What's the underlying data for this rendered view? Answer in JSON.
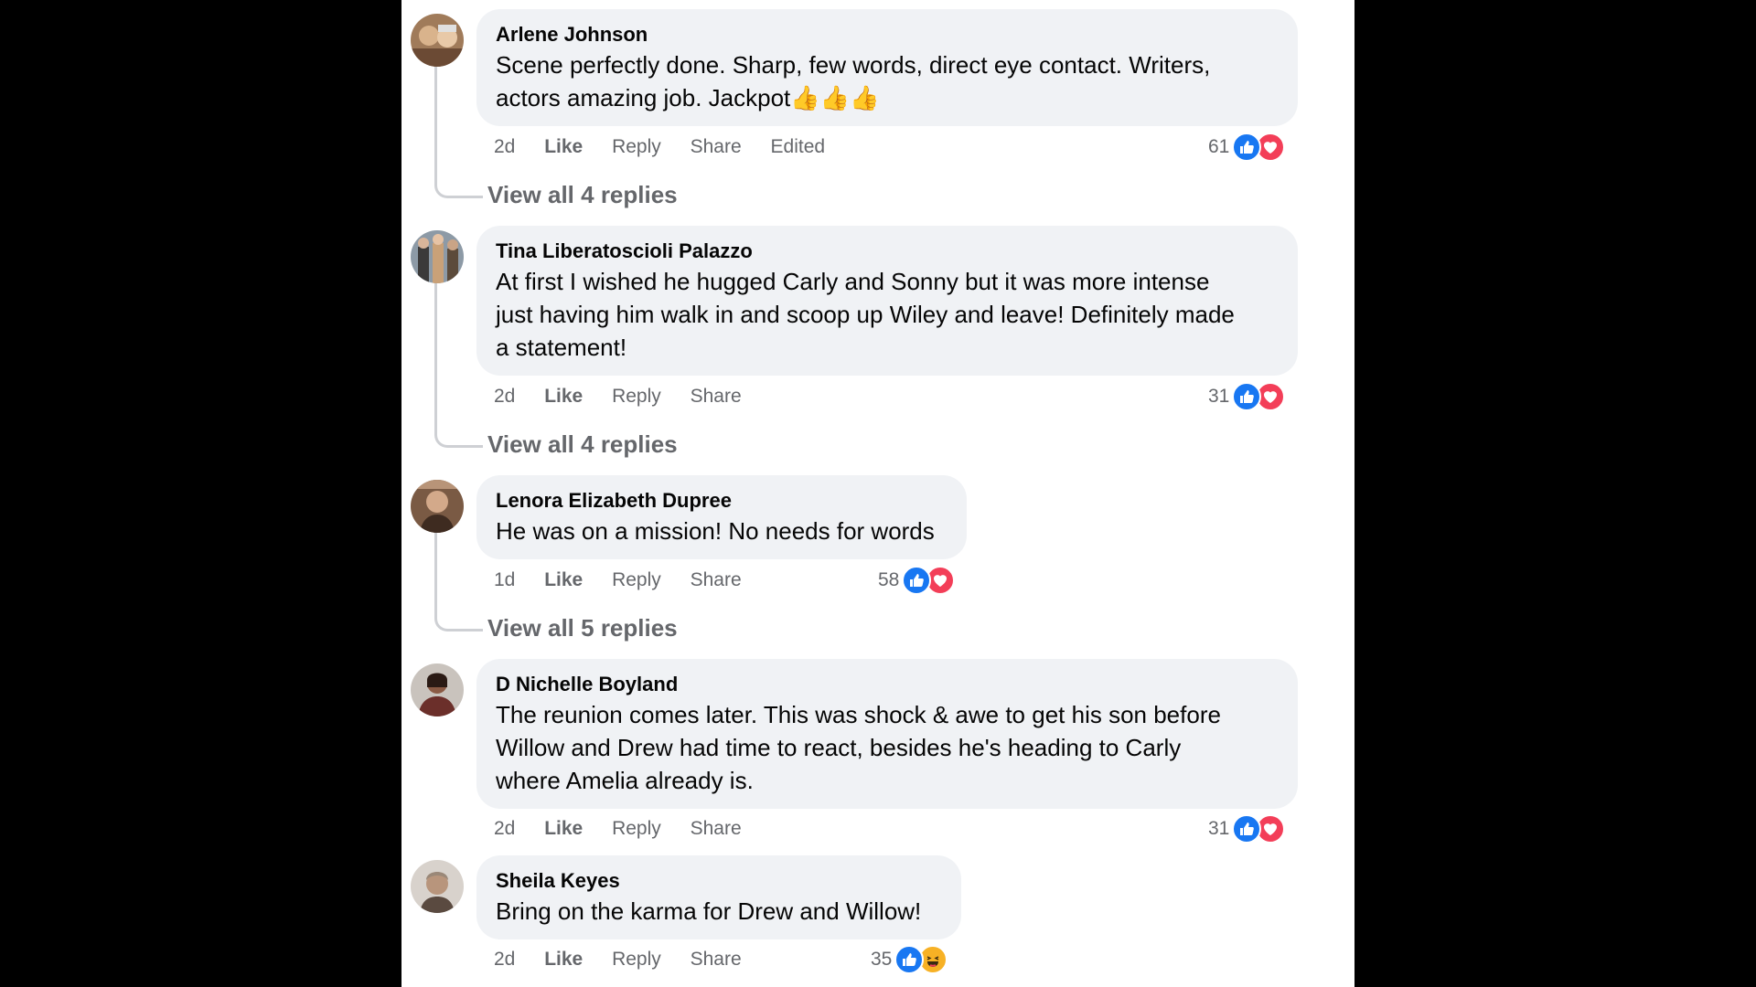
{
  "comments": [
    {
      "author": "Arlene Johnson",
      "lines": [
        "Scene perfectly done. Sharp, few words, direct eye contact. Writers,",
        "actors amazing job. Jackpot👍👍👍"
      ],
      "time": "2d",
      "like": "Like",
      "reply": "Reply",
      "share": "Share",
      "edited": "Edited",
      "reaction_count": "61",
      "reactions": [
        "like-icon",
        "heart-icon"
      ],
      "view_replies": "View all 4 replies"
    },
    {
      "author": "Tina Liberatoscioli Palazzo",
      "lines": [
        "At first I wished he hugged Carly and Sonny but it was more intense",
        "just having him walk in and scoop up Wiley and leave! Definitely made",
        "a statement!"
      ],
      "time": "2d",
      "like": "Like",
      "reply": "Reply",
      "share": "Share",
      "reaction_count": "31",
      "reactions": [
        "like-icon",
        "heart-icon"
      ],
      "view_replies": "View all 4 replies"
    },
    {
      "author": "Lenora Elizabeth Dupree",
      "lines": [
        "He was on a mission! No needs for words"
      ],
      "time": "1d",
      "like": "Like",
      "reply": "Reply",
      "share": "Share",
      "reaction_count": "58",
      "reactions": [
        "like-icon",
        "heart-icon"
      ],
      "view_replies": "View all 5 replies"
    },
    {
      "author": "D Nichelle Boyland",
      "lines": [
        "The reunion comes later. This was shock & awe to get his son before",
        "Willow and Drew had time to react, besides he's heading to Carly",
        "where Amelia already is."
      ],
      "time": "2d",
      "like": "Like",
      "reply": "Reply",
      "share": "Share",
      "reaction_count": "31",
      "reactions": [
        "like-icon",
        "heart-icon"
      ]
    },
    {
      "author": "Sheila Keyes",
      "lines": [
        "Bring on the karma for Drew and Willow!"
      ],
      "time": "2d",
      "like": "Like",
      "reply": "Reply",
      "share": "Share",
      "reaction_count": "35",
      "reactions": [
        "like-icon",
        "haha-icon"
      ]
    }
  ],
  "colors": {
    "like": "#1877f2",
    "love": "#f33e58",
    "haha": "#f7b125",
    "bubble": "#f0f2f5"
  }
}
